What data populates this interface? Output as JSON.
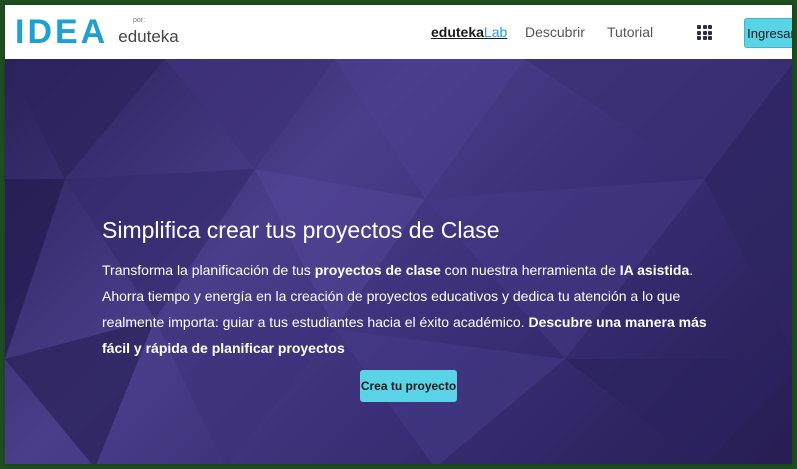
{
  "brand": {
    "mark": "IDEA",
    "por": "por:",
    "sub": "eduteka"
  },
  "nav": {
    "lab_main": "eduteka",
    "lab_accent": "Lab",
    "descubrir": "Descubrir",
    "tutorial": "Tutorial",
    "ingresar": "Ingresar"
  },
  "hero": {
    "title": "Simplifica crear tus proyectos de Clase",
    "desc_1": "Transforma la planificación de tus ",
    "desc_b1": "proyectos de clase",
    "desc_2": " con nuestra herramienta de ",
    "desc_b2": "IA asistida",
    "desc_3": ". Ahorra tiempo y energía en la creación de proyectos educativos y dedica tu atención a lo que realmente importa: guiar a tus estudiantes hacia el éxito académico. ",
    "desc_b3": "Descubre una manera más fácil y rápida de planificar proyectos",
    "cta": "Crea tu proyecto"
  },
  "colors": {
    "accent": "#5bd3e6",
    "logo": "#1f9fd4",
    "hero_bg": "#3a2e6e"
  }
}
